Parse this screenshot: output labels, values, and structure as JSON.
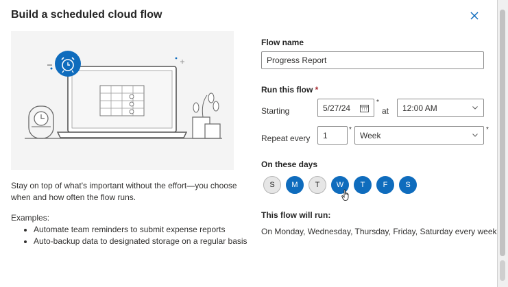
{
  "dialog": {
    "title": "Build a scheduled cloud flow",
    "description": "Stay on top of what's important without the effort—you choose when and how often the flow runs.",
    "examples_label": "Examples:",
    "examples": [
      "Automate team reminders to submit expense reports",
      "Auto-backup data to designated storage on a regular basis"
    ]
  },
  "form": {
    "flow_name_label": "Flow name",
    "flow_name_value": "Progress Report",
    "run_label": "Run this flow",
    "required_mark": "*",
    "starting_label": "Starting",
    "start_date": "5/27/24",
    "at_label": "at",
    "start_time": "12:00 AM",
    "repeat_label": "Repeat every",
    "repeat_interval": "1",
    "repeat_unit": "Week",
    "days_label": "On these days",
    "days": [
      {
        "letter": "S",
        "selected": false
      },
      {
        "letter": "M",
        "selected": true
      },
      {
        "letter": "T",
        "selected": false
      },
      {
        "letter": "W",
        "selected": true
      },
      {
        "letter": "T",
        "selected": true
      },
      {
        "letter": "F",
        "selected": true
      },
      {
        "letter": "S",
        "selected": true
      }
    ],
    "summary_label": "This flow will run:",
    "summary_text": "On Monday, Wednesday, Thursday, Friday, Saturday every week"
  },
  "icons": {
    "close": "close-icon",
    "calendar": "calendar-icon",
    "chevron": "chevron-down-icon",
    "alarm": "alarm-clock-icon",
    "pointer": "hand-pointer-icon"
  },
  "colors": {
    "accent": "#0f6cbd",
    "unselected_day": "#e6e6e6",
    "illustration_bg": "#f4f4f4"
  }
}
